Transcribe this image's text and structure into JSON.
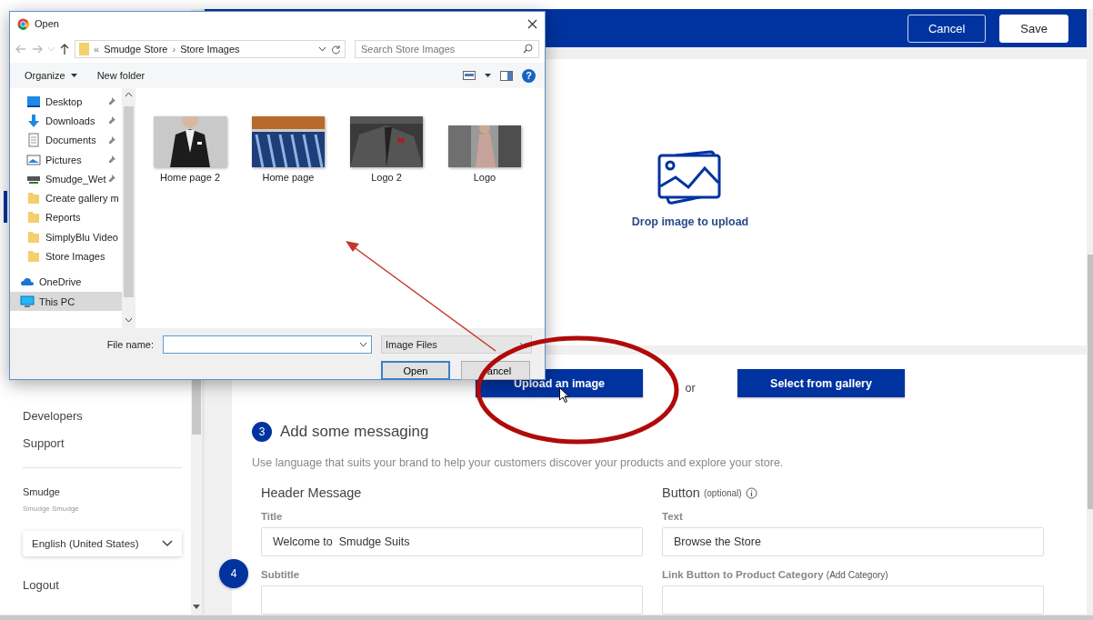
{
  "header": {
    "buttons": [
      {
        "label": "Cancel",
        "kind": "outline"
      },
      {
        "label": "Save",
        "kind": "solid"
      }
    ]
  },
  "upload": {
    "prompt": "Drop image to upload",
    "upload_button": "Upload an image",
    "separator": "or",
    "gallery_button": "Select from gallery"
  },
  "step3": {
    "number": "3",
    "title": "Add some messaging",
    "description": "Use language that suits your brand to help your customers discover your products and explore your store."
  },
  "header_message": {
    "heading": "Header Message",
    "title_label": "Title",
    "title_value": "Welcome to  Smudge Suits",
    "subtitle_label": "Subtitle"
  },
  "button_section": {
    "heading": "Button",
    "note": "(optional)",
    "text_label": "Text",
    "text_value": "Browse the Store",
    "link_label": "Link Button to Product Category",
    "link_note": "(Add Category)"
  },
  "step4": {
    "number": "4"
  },
  "sidebar": {
    "items": [
      "Developers",
      "Support"
    ],
    "user_name": "Smudge",
    "user_sub": "Smudge Smudge",
    "language": "English (United States)",
    "logout": "Logout"
  },
  "dialog": {
    "title": "Open",
    "path_prefix": "«",
    "path": [
      "Smudge Store",
      "Store Images"
    ],
    "path_separator": "›",
    "search_placeholder": "Search Store Images",
    "toolbar": [
      "Organize",
      "New folder"
    ],
    "help_glyph": "?",
    "nav": [
      {
        "label": "Desktop",
        "kind": "desktop",
        "pinned": true,
        "selected": false
      },
      {
        "label": "Downloads",
        "kind": "downloads",
        "pinned": true,
        "selected": false
      },
      {
        "label": "Documents",
        "kind": "documents",
        "pinned": true,
        "selected": false
      },
      {
        "label": "Pictures",
        "kind": "pictures",
        "pinned": true,
        "selected": false
      },
      {
        "label": "Smudge_Wet",
        "kind": "drive",
        "pinned": true,
        "selected": false
      },
      {
        "label": "Create gallery m",
        "kind": "folder",
        "pinned": false,
        "selected": false
      },
      {
        "label": "Reports",
        "kind": "folder",
        "pinned": false,
        "selected": false
      },
      {
        "label": "SimplyBlu Video",
        "kind": "folder",
        "pinned": false,
        "selected": false
      },
      {
        "label": "Store Images",
        "kind": "folder",
        "pinned": false,
        "selected": false
      },
      {
        "label": "OneDrive",
        "kind": "cloud",
        "pinned": false,
        "selected": false
      },
      {
        "label": "This PC",
        "kind": "pc",
        "pinned": false,
        "selected": true
      }
    ],
    "files": [
      {
        "name": "Home page 2",
        "kind": "picture"
      },
      {
        "name": "Home page",
        "kind": "picture"
      },
      {
        "name": "Logo 2",
        "kind": "picture"
      },
      {
        "name": "Logo",
        "kind": "picture"
      }
    ],
    "file_name_label": "File name:",
    "file_type": "Image Files",
    "buttons": [
      {
        "label": "Open",
        "kind": "default"
      },
      {
        "label": "ancel",
        "kind": "normal"
      }
    ]
  }
}
